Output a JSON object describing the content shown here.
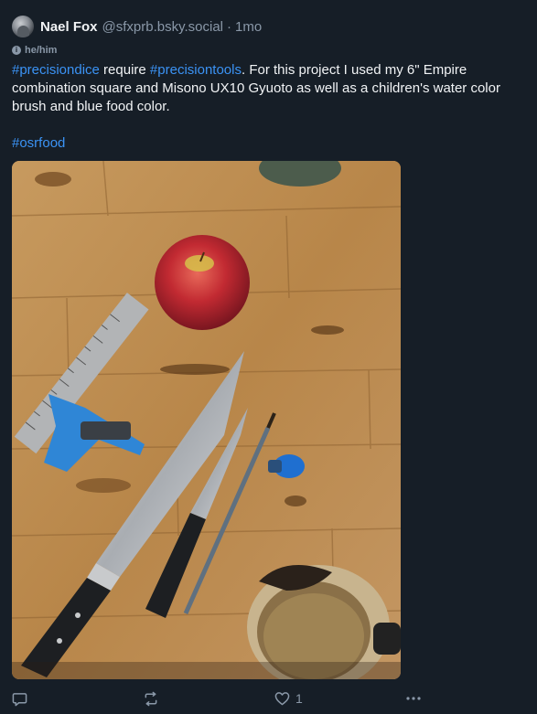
{
  "author": {
    "display_name": "Nael Fox",
    "handle": "@sfxprb.bsky.social",
    "separator": "·",
    "time": "1mo",
    "pronouns": "he/him"
  },
  "post": {
    "tag_precisiondice": "#precisiondice",
    "text_require": " require ",
    "tag_precisiontools": "#precisiontools",
    "text_body": ". For this project I used my 6\" Empire combination square and Misono UX10 Gyuoto as well as a children's water color brush and blue food color.",
    "tag_osrfood": "#osrfood"
  },
  "actions": {
    "like_count": "1"
  },
  "icons": {
    "reply": "reply-icon",
    "repost": "repost-icon",
    "like": "heart-icon",
    "more": "more-icon",
    "pronouns": "info-icon"
  },
  "colors": {
    "background": "#161e27",
    "hashtag": "#3b93f5",
    "muted": "#8a98a8"
  }
}
